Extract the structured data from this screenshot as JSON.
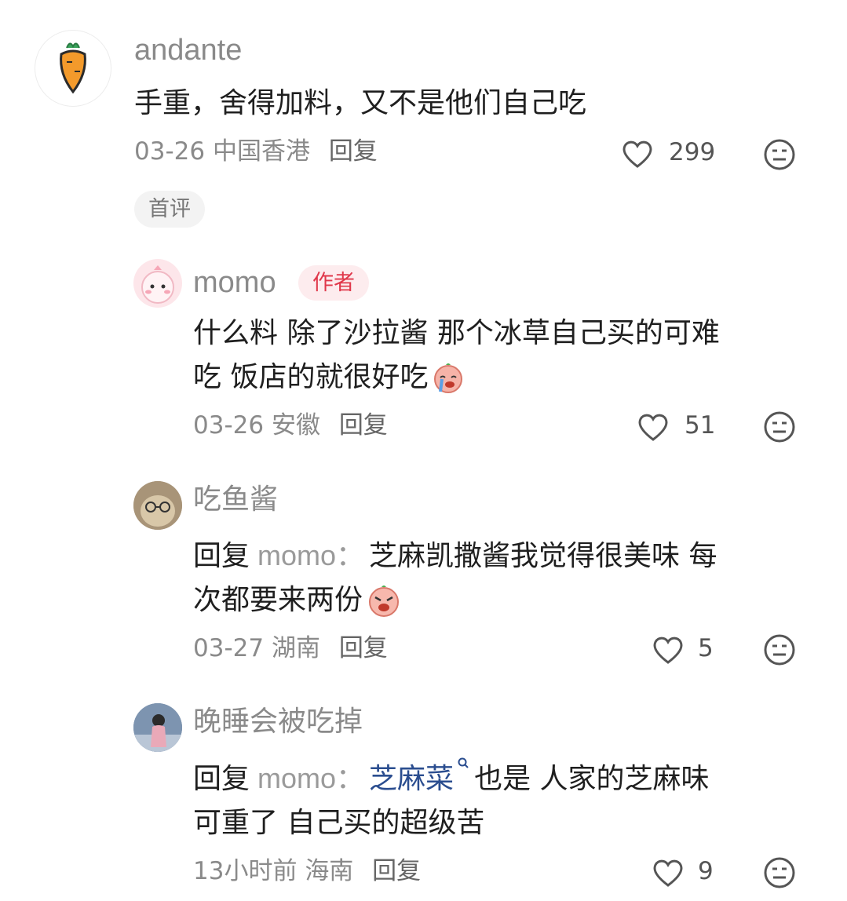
{
  "comments": [
    {
      "username": "andante",
      "text": "手重，舍得加料，又不是他们自己吃",
      "date": "03-26",
      "location": "中国香港",
      "reply_label": "回复",
      "likes": "299",
      "tag": "首评",
      "avatar_icon": "carrot-icon"
    }
  ],
  "replies": [
    {
      "username": "momo",
      "badge": "作者",
      "text_line1": "什么料 除了沙拉酱 那个冰草自己买的可难",
      "text_line2": "吃 饭店的就很好吃",
      "emoji": "crying-face-sticker-icon",
      "date": "03-26",
      "location": "安徽",
      "reply_label": "回复",
      "likes": "51"
    },
    {
      "username": "吃鱼酱",
      "prefix": "回复",
      "target": "momo：",
      "text_line1": "芝麻凯撒酱我觉得很美味 每",
      "text_line2": "次都要来两份",
      "emoji": "angry-face-sticker-icon",
      "date": "03-27",
      "location": "湖南",
      "reply_label": "回复",
      "likes": "5"
    },
    {
      "username": "晚睡会被吃掉",
      "prefix": "回复",
      "target": "momo：",
      "link_text": "芝麻菜",
      "text_line1_rest": "也是 人家的芝麻味",
      "text_line2": "可重了 自己买的超级苦",
      "date": "13小时前",
      "location": "海南",
      "reply_label": "回复",
      "likes": "9"
    }
  ],
  "colors": {
    "accent_red": "#e0384b",
    "link_blue": "#2a4d8f",
    "gray_text": "#8a8a8a"
  }
}
